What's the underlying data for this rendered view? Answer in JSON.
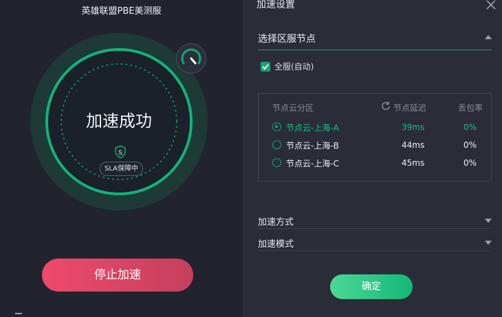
{
  "left": {
    "game_title": "英雄联盟PBE美测服",
    "status": "加速成功",
    "sla_badge": "SLA保障中",
    "stop_button": "停止加速"
  },
  "right": {
    "title": "加速设置",
    "section_title": "选择区服节点",
    "all_server_label": "全服(自动)",
    "all_server_checked": true,
    "table": {
      "headers": [
        "节点云分区",
        "节点延迟",
        "丢包率"
      ],
      "rows": [
        {
          "name": "节点云-上海-A",
          "delay": "39ms",
          "loss": "0%",
          "selected": true
        },
        {
          "name": "节点云-上海-B",
          "delay": "44ms",
          "loss": "0%",
          "selected": false
        },
        {
          "name": "节点云-上海-C",
          "delay": "45ms",
          "loss": "0%",
          "selected": false
        }
      ]
    },
    "accel_method": "加速方式",
    "accel_mode": "加速模式",
    "confirm_button": "确定"
  },
  "colors": {
    "accent": "#12a774",
    "stop_button": "#ef4a6b",
    "background_left": "#21232d",
    "background_right": "#2a2d38"
  },
  "icons": [
    "shield-icon",
    "gauge-icon",
    "close-icon",
    "refresh-icon",
    "check-icon"
  ]
}
